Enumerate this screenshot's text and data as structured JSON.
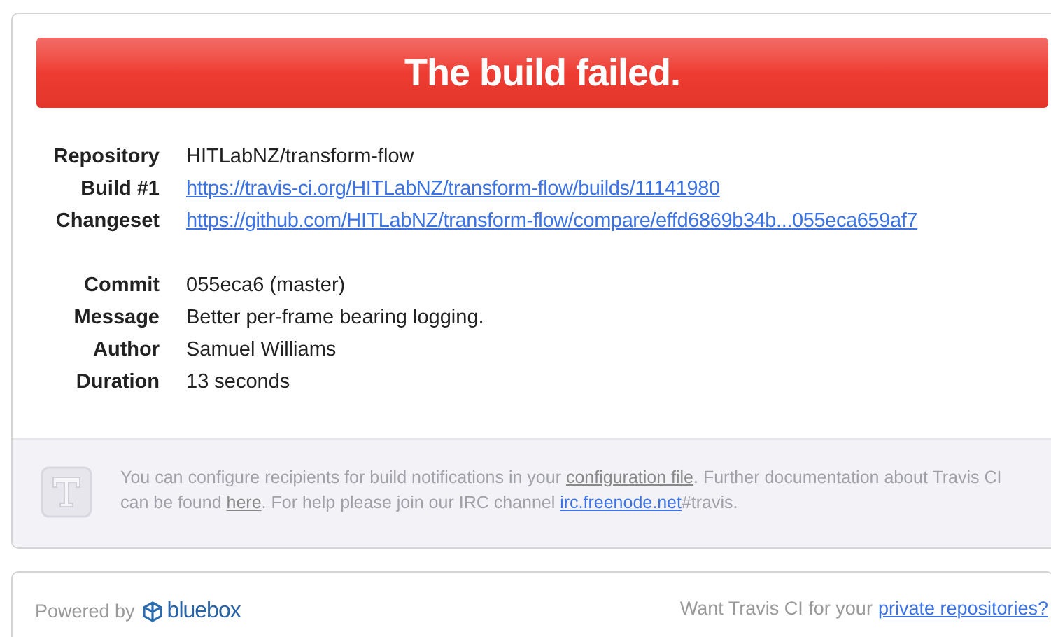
{
  "banner": {
    "title": "The build failed."
  },
  "details": [
    {
      "label": "Repository",
      "value": "HITLabNZ/transform-flow",
      "kind": "text"
    },
    {
      "label": "Build #1",
      "value": "https://travis-ci.org/HITLabNZ/transform-flow/builds/11141980",
      "kind": "link"
    },
    {
      "label": "Changeset",
      "value": "https://github.com/HITLabNZ/transform-flow/compare/effd6869b34b...055eca659af7",
      "kind": "link"
    },
    {
      "kind": "spacer"
    },
    {
      "label": "Commit",
      "value": "055eca6 (master)",
      "kind": "text"
    },
    {
      "label": "Message",
      "value": "Better per-frame bearing logging.",
      "kind": "text"
    },
    {
      "label": "Author",
      "value": "Samuel Williams",
      "kind": "text"
    },
    {
      "label": "Duration",
      "value": "13 seconds",
      "kind": "text"
    }
  ],
  "notice": {
    "segments": [
      {
        "text": "You can configure recipients for build notifications in your ",
        "kind": "text"
      },
      {
        "text": "configuration file",
        "kind": "doc-link"
      },
      {
        "text": ". Further documentation about Travis CI can be found ",
        "kind": "text"
      },
      {
        "text": "here",
        "kind": "doc-link"
      },
      {
        "text": ". For help please join our IRC channel ",
        "kind": "text"
      },
      {
        "text": "irc.freenode.net",
        "kind": "link"
      },
      {
        "text": "#travis.",
        "kind": "text"
      }
    ]
  },
  "footer": {
    "powered_by": "Powered by",
    "sponsor": "bluebox",
    "prompt": "Want Travis CI for your",
    "link": "private repositories?"
  }
}
